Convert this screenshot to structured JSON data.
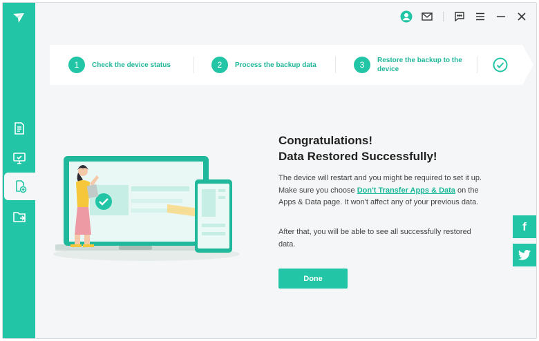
{
  "colors": {
    "accent": "#22c5a5",
    "accent_text": "#19b899",
    "background": "#f5f6f7"
  },
  "sidebar": {
    "items": [
      {
        "icon": "document-icon",
        "active": false
      },
      {
        "icon": "monitor-check-icon",
        "active": false
      },
      {
        "icon": "restore-icon",
        "active": true
      },
      {
        "icon": "folder-export-icon",
        "active": false
      }
    ]
  },
  "titlebar": {
    "icons": [
      "user-icon",
      "mail-icon",
      "feedback-icon",
      "menu-icon",
      "minimize-icon",
      "close-icon"
    ]
  },
  "steps": [
    {
      "number": "1",
      "label": "Check the device status"
    },
    {
      "number": "2",
      "label": "Process the backup data"
    },
    {
      "number": "3",
      "label_line1": "Restore the backup to the",
      "label_line2": "device"
    }
  ],
  "main": {
    "title_line1": "Congratulations!",
    "title_line2": "Data Restored Successfully!",
    "para1_before": "The device will restart and you might be required to set it up. Make sure you choose ",
    "para1_link": "Don't Transfer Apps & Data",
    "para1_after": " on the Apps & Data page. It won't affect any of your previous data.",
    "para2": "After that, you will be able to see all successfully restored data.",
    "done_label": "Done"
  },
  "social": {
    "facebook": "f"
  }
}
